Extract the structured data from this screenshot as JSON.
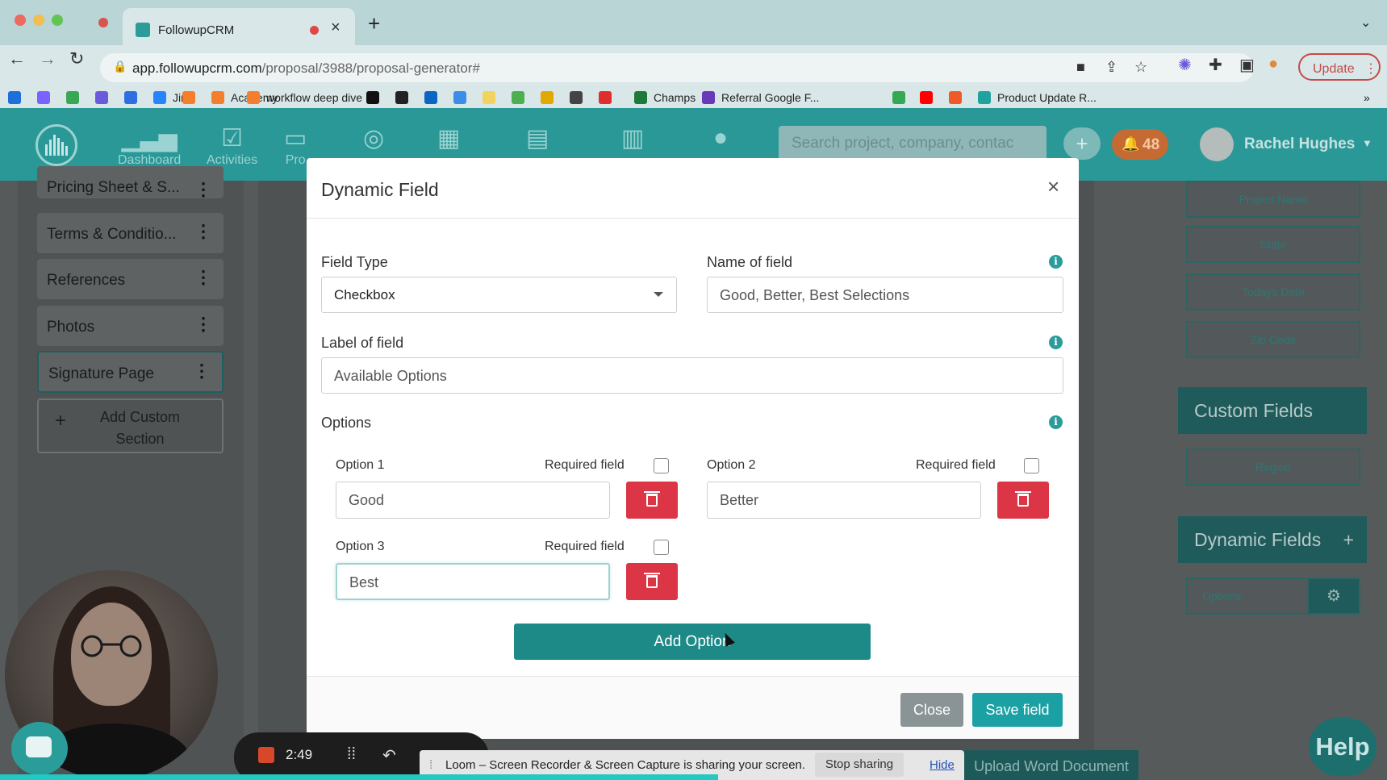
{
  "browser": {
    "tab_title": "FollowupCRM",
    "url_domain": "app.followupcrm.com",
    "url_path": "/proposal/3988/proposal-generator#",
    "update_label": "Update",
    "bookmarks": [
      {
        "label": "",
        "color": "#1e6fd9"
      },
      {
        "label": "",
        "color": "#7b61ff"
      },
      {
        "label": "",
        "color": "#3aa757"
      },
      {
        "label": "",
        "color": "#6a5bdb"
      },
      {
        "label": "",
        "color": "#2d6ee0"
      },
      {
        "label": "Jira",
        "color": "#2684ff"
      },
      {
        "label": "",
        "color": "#f57e2c"
      },
      {
        "label": "Academy",
        "color": "#f57e2c"
      },
      {
        "label": "workflow deep dive",
        "color": "#f57e2c"
      },
      {
        "label": "",
        "color": "#111111"
      },
      {
        "label": "",
        "color": "#222222"
      },
      {
        "label": "",
        "color": "#0a66c2"
      },
      {
        "label": "",
        "color": "#3b8ee8"
      },
      {
        "label": "",
        "color": "#f2d35e"
      },
      {
        "label": "",
        "color": "#4caf50"
      },
      {
        "label": "",
        "color": "#e0a800"
      },
      {
        "label": "",
        "color": "#444444"
      },
      {
        "label": "",
        "color": "#e02d2d"
      },
      {
        "label": "Champs",
        "color": "#1d7b3a"
      },
      {
        "label": "Referral Google F...",
        "color": "#673ab7"
      },
      {
        "label": "",
        "color": "#34a853"
      },
      {
        "label": "",
        "color": "#ff0000"
      },
      {
        "label": "",
        "color": "#ef5a2a"
      },
      {
        "label": "Product Update R...",
        "color": "#20a39e"
      }
    ],
    "bookmarks_overflow": "»"
  },
  "app_header": {
    "nav": [
      {
        "label": "Dashboard",
        "icon": "bar-chart-icon"
      },
      {
        "label": "Activities",
        "icon": "checklist-icon"
      },
      {
        "label": "Pro",
        "icon": "folder-icon"
      },
      {
        "label": "",
        "icon": "target-icon"
      },
      {
        "label": "",
        "icon": "calendar-icon"
      },
      {
        "label": "",
        "icon": "documents-icon"
      },
      {
        "label": "",
        "icon": "calculator-icon"
      },
      {
        "label": "",
        "icon": "person-icon"
      }
    ],
    "search_placeholder": "Search project, company, contac",
    "notification_count": "48",
    "user_name": "Rachel Hughes"
  },
  "left_sections": {
    "items": [
      "Pricing Sheet & S...",
      "Terms & Conditio...",
      "References",
      "Photos",
      "Signature Page"
    ],
    "add_custom_line1": "Add Custom",
    "add_custom_line2": "Section"
  },
  "right_panel": {
    "fields": [
      "Project Name",
      "State",
      "Todays Date",
      "Zip Code"
    ],
    "custom_fields_title": "Custom Fields",
    "custom_fields": [
      "Region"
    ],
    "dynamic_fields_title": "Dynamic Fields",
    "dynamic_fields_add": "+",
    "dynamic_fields": [
      "Options"
    ]
  },
  "modal": {
    "title": "Dynamic Field",
    "close_symbol": "×",
    "field_type_label": "Field Type",
    "field_type_value": "Checkbox",
    "name_label": "Name of field",
    "name_value": "Good, Better, Best Selections",
    "label_label": "Label of field",
    "label_value": "Available Options",
    "options_label": "Options",
    "required_label": "Required field",
    "options": [
      {
        "label": "Option 1",
        "value": "Good"
      },
      {
        "label": "Option 2",
        "value": "Better"
      },
      {
        "label": "Option 3",
        "value": "Best"
      }
    ],
    "add_option_label": "Add Option",
    "close_label": "Close",
    "save_label": "Save field"
  },
  "overlay": {
    "loom_time": "2:49",
    "share_text": "Loom – Screen Recorder & Screen Capture is sharing your screen.",
    "stop_sharing": "Stop sharing",
    "hide": "Hide",
    "upload_doc": "Upload Word Document",
    "help": "Help"
  }
}
